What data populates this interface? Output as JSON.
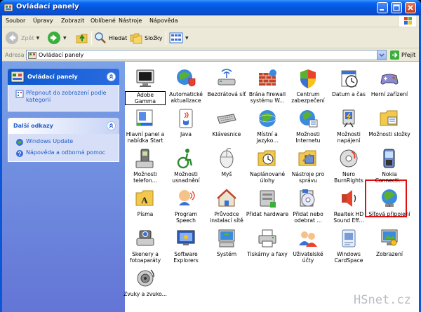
{
  "window": {
    "title": "Ovládací panely"
  },
  "menu": [
    "Soubor",
    "Úpravy",
    "Zobrazit",
    "Oblíbené",
    "Nástroje",
    "Nápověda"
  ],
  "toolbar": {
    "back": "Zpět",
    "search": "Hledat",
    "folders": "Složky"
  },
  "address": {
    "label": "Adresa",
    "value": "Ovládací panely",
    "go": "Přejít"
  },
  "taskpane": {
    "main_title": "Ovládací panely",
    "main_link": "Přepnout do zobrazení podle kategorií",
    "more_title": "Další odkazy",
    "more_links": [
      "Windows Update",
      "Nápověda a odborná pomoc"
    ]
  },
  "icons": [
    {
      "label": "Adobe Gamma",
      "icon": "monitor-icon"
    },
    {
      "label": "Automatické aktualizace",
      "icon": "globe-shield-icon"
    },
    {
      "label": "Bezdrátová síť",
      "icon": "wireless-network-icon"
    },
    {
      "label": "Brána firewall systému W...",
      "icon": "firewall-icon"
    },
    {
      "label": "Centrum zabezpečení",
      "icon": "security-shield-icon"
    },
    {
      "label": "Datum a čas",
      "icon": "clock-icon"
    },
    {
      "label": "Herní zařízení",
      "icon": "gamepad-icon"
    },
    {
      "label": "Hlavní panel a nabídka Start",
      "icon": "taskbar-icon"
    },
    {
      "label": "Java",
      "icon": "java-icon"
    },
    {
      "label": "Klávesnice",
      "icon": "keyboard-icon"
    },
    {
      "label": "Místní a jazyko...",
      "icon": "globe-icon"
    },
    {
      "label": "Možnosti Internetu",
      "icon": "internet-options-icon"
    },
    {
      "label": "Možnosti napájení",
      "icon": "power-icon"
    },
    {
      "label": "Možnosti složky",
      "icon": "folder-options-icon"
    },
    {
      "label": "Možnosti telefon...",
      "icon": "phone-modem-icon"
    },
    {
      "label": "Možnosti usnadnění",
      "icon": "accessibility-icon"
    },
    {
      "label": "Myš",
      "icon": "mouse-icon"
    },
    {
      "label": "Naplánované úlohy",
      "icon": "scheduled-tasks-icon"
    },
    {
      "label": "Nástroje pro správu",
      "icon": "admin-tools-icon"
    },
    {
      "label": "Nero BurnRights",
      "icon": "nero-icon"
    },
    {
      "label": "Nokia Connecti...",
      "icon": "nokia-phone-icon"
    },
    {
      "label": "Písma",
      "icon": "fonts-folder-icon"
    },
    {
      "label": "Program Speech",
      "icon": "speech-icon"
    },
    {
      "label": "Průvodce instalací sítě",
      "icon": "network-wizard-icon"
    },
    {
      "label": "Přidat hardware",
      "icon": "add-hardware-icon"
    },
    {
      "label": "Přidat nebo odebrat ...",
      "icon": "add-remove-programs-icon"
    },
    {
      "label": "Realtek HD Sound Eff...",
      "icon": "speaker-icon"
    },
    {
      "label": "Síťová připojení",
      "icon": "network-connections-icon"
    },
    {
      "label": "Skenery a fotoaparáty",
      "icon": "scanner-camera-icon"
    },
    {
      "label": "Software Explorers",
      "icon": "software-explorers-icon"
    },
    {
      "label": "Systém",
      "icon": "system-icon"
    },
    {
      "label": "Tiskárny a faxy",
      "icon": "printer-icon"
    },
    {
      "label": "Uživatelské účty",
      "icon": "user-accounts-icon"
    },
    {
      "label": "Windows CardSpace",
      "icon": "cardspace-icon"
    },
    {
      "label": "Zobrazení",
      "icon": "display-icon"
    },
    {
      "label": "Zvuky a zvuko...",
      "icon": "sounds-icon"
    }
  ],
  "watermark": "HSnet.cz",
  "colors": {
    "titlebar": "#0455de",
    "taskpane": "#6f8ee0",
    "highlight": "#e01010",
    "link": "#215dc6"
  }
}
